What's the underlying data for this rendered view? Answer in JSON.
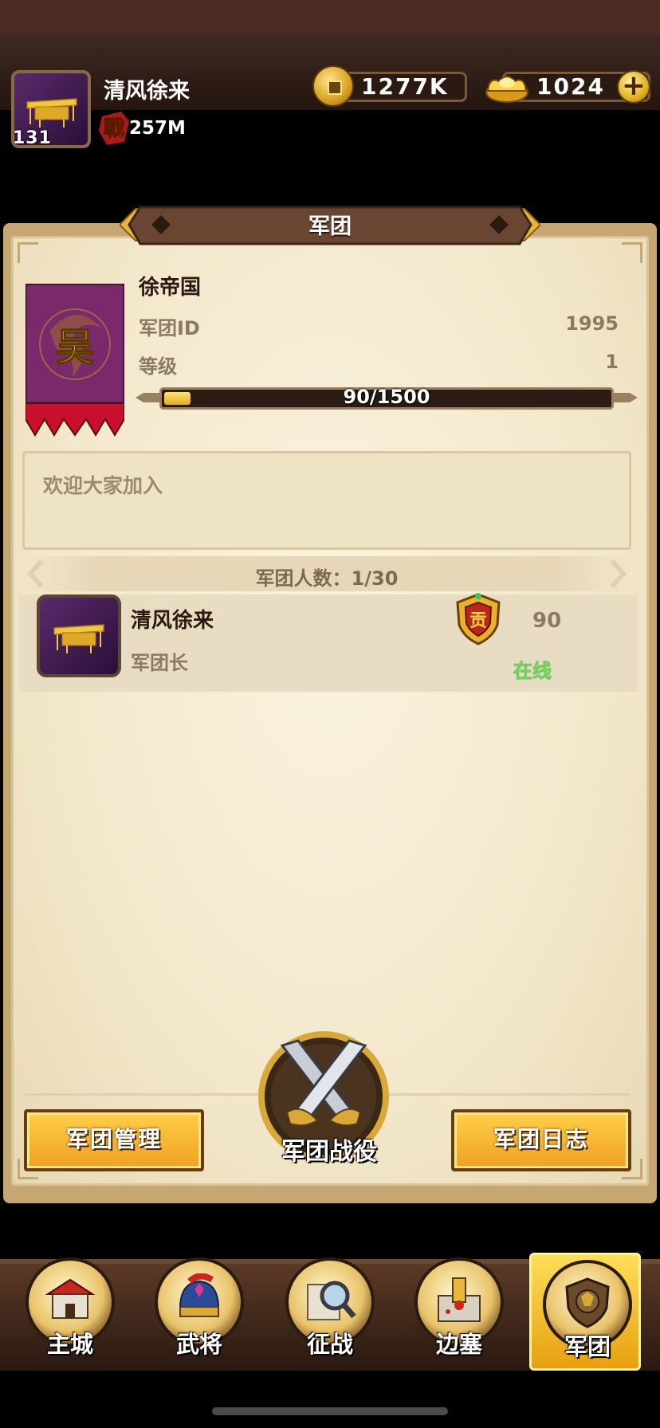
{
  "player": {
    "name": "清风徐来",
    "level": "131",
    "power": "257M",
    "battle_glyph": "戰"
  },
  "resources": {
    "coins": "1277K",
    "gold": "1024"
  },
  "panel": {
    "title": "军团"
  },
  "legion": {
    "name": "徐帝国",
    "banner_char": "吴",
    "id_label": "军团ID",
    "id_value": "1995",
    "level_label": "等级",
    "level_value": "1",
    "exp_text": "90/1500",
    "exp_fraction": 0.06,
    "notice": "欢迎大家加入",
    "member_count": "军团人数：1/30"
  },
  "members": [
    {
      "name": "清风徐来",
      "role": "军团长",
      "badge_char": "贡",
      "contribution": "90",
      "status": "在线"
    }
  ],
  "actions": {
    "manage": "军团管理",
    "campaign": "军团战役",
    "log": "军团日志"
  },
  "nav": {
    "items": [
      {
        "label": "主城",
        "icon": "castle-icon"
      },
      {
        "label": "武将",
        "icon": "general-helmet-icon"
      },
      {
        "label": "征战",
        "icon": "magnifier-map-icon"
      },
      {
        "label": "边塞",
        "icon": "frontier-tower-icon"
      },
      {
        "label": "军团",
        "icon": "legion-shield-icon"
      }
    ],
    "active": "军团"
  },
  "colors": {
    "online": "#6ad65a",
    "button": "#f0a020",
    "panel": "#f3e8cc"
  }
}
